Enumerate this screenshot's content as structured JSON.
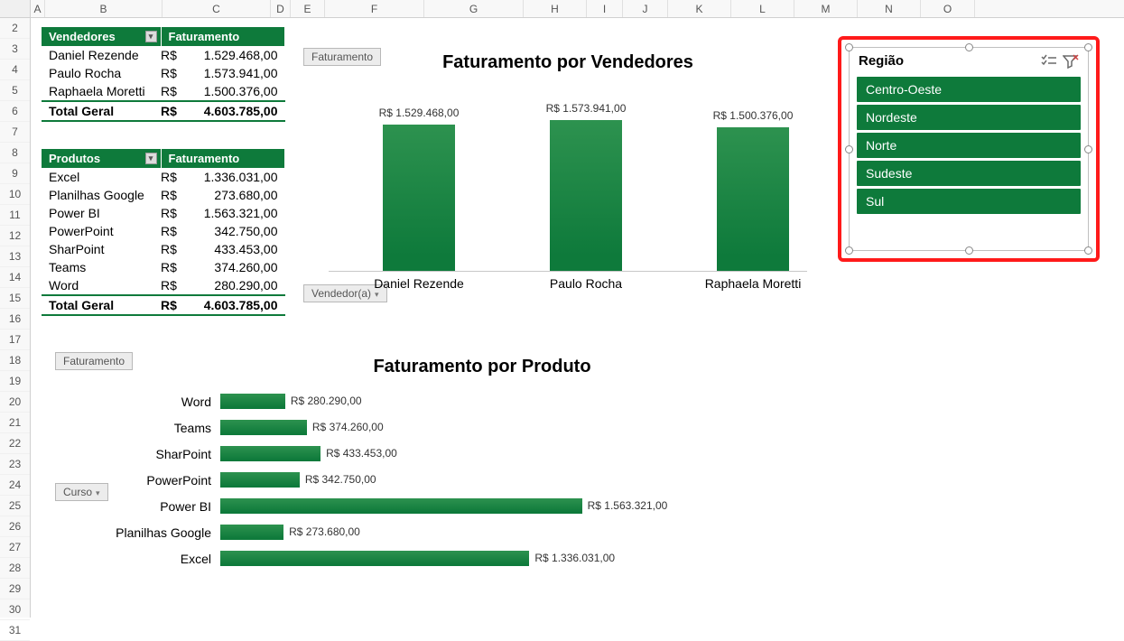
{
  "columns": {
    "letters": [
      "A",
      "B",
      "C",
      "D",
      "E",
      "F",
      "G",
      "H",
      "I",
      "J",
      "K",
      "L",
      "M",
      "N",
      "O"
    ],
    "widths": [
      16,
      130,
      120,
      22,
      38,
      110,
      110,
      70,
      40,
      50,
      70,
      70,
      70,
      70,
      60
    ]
  },
  "rows_visible": 30,
  "pivot_vendedores": {
    "headers": [
      "Vendedores",
      "Faturamento"
    ],
    "rows": [
      {
        "name": "Daniel Rezende",
        "cur": "R$",
        "value": "1.529.468,00"
      },
      {
        "name": "Paulo Rocha",
        "cur": "R$",
        "value": "1.573.941,00"
      },
      {
        "name": "Raphaela Moretti",
        "cur": "R$",
        "value": "1.500.376,00"
      }
    ],
    "total": {
      "name": "Total Geral",
      "cur": "R$",
      "value": "4.603.785,00"
    }
  },
  "pivot_produtos": {
    "headers": [
      "Produtos",
      "Faturamento"
    ],
    "rows": [
      {
        "name": "Excel",
        "cur": "R$",
        "value": "1.336.031,00"
      },
      {
        "name": "Planilhas Google",
        "cur": "R$",
        "value": "273.680,00"
      },
      {
        "name": "Power BI",
        "cur": "R$",
        "value": "1.563.321,00"
      },
      {
        "name": "PowerPoint",
        "cur": "R$",
        "value": "342.750,00"
      },
      {
        "name": "SharPoint",
        "cur": "R$",
        "value": "433.453,00"
      },
      {
        "name": "Teams",
        "cur": "R$",
        "value": "374.260,00"
      },
      {
        "name": "Word",
        "cur": "R$",
        "value": "280.290,00"
      }
    ],
    "total": {
      "name": "Total Geral",
      "cur": "R$",
      "value": "4.603.785,00"
    }
  },
  "chips": {
    "faturamento1": "Faturamento",
    "vendedor": "Vendedor(a)",
    "faturamento2": "Faturamento",
    "curso": "Curso"
  },
  "chart_data": [
    {
      "type": "bar",
      "title": "Faturamento por Vendedores",
      "xlabel": "",
      "ylabel": "",
      "categories": [
        "Daniel Rezende",
        "Paulo Rocha",
        "Raphaela Moretti"
      ],
      "values": [
        1529468,
        1573941,
        1500376
      ],
      "value_labels": [
        "R$ 1.529.468,00",
        "R$ 1.573.941,00",
        "R$ 1.500.376,00"
      ],
      "ylim": [
        0,
        1600000
      ]
    },
    {
      "type": "bar",
      "orientation": "horizontal",
      "title": "Faturamento por Produto",
      "categories": [
        "Word",
        "Teams",
        "SharPoint",
        "PowerPoint",
        "Power BI",
        "Planilhas Google",
        "Excel"
      ],
      "values": [
        280290,
        374260,
        433453,
        342750,
        1563321,
        273680,
        1336031
      ],
      "value_labels": [
        "R$ 280.290,00",
        "R$ 374.260,00",
        "R$ 433.453,00",
        "R$ 342.750,00",
        "R$ 1.563.321,00",
        "R$ 273.680,00",
        "R$ 1.336.031,00"
      ],
      "xlim": [
        0,
        1600000
      ]
    }
  ],
  "slicer": {
    "title": "Região",
    "items": [
      "Centro-Oeste",
      "Nordeste",
      "Norte",
      "Sudeste",
      "Sul"
    ]
  }
}
